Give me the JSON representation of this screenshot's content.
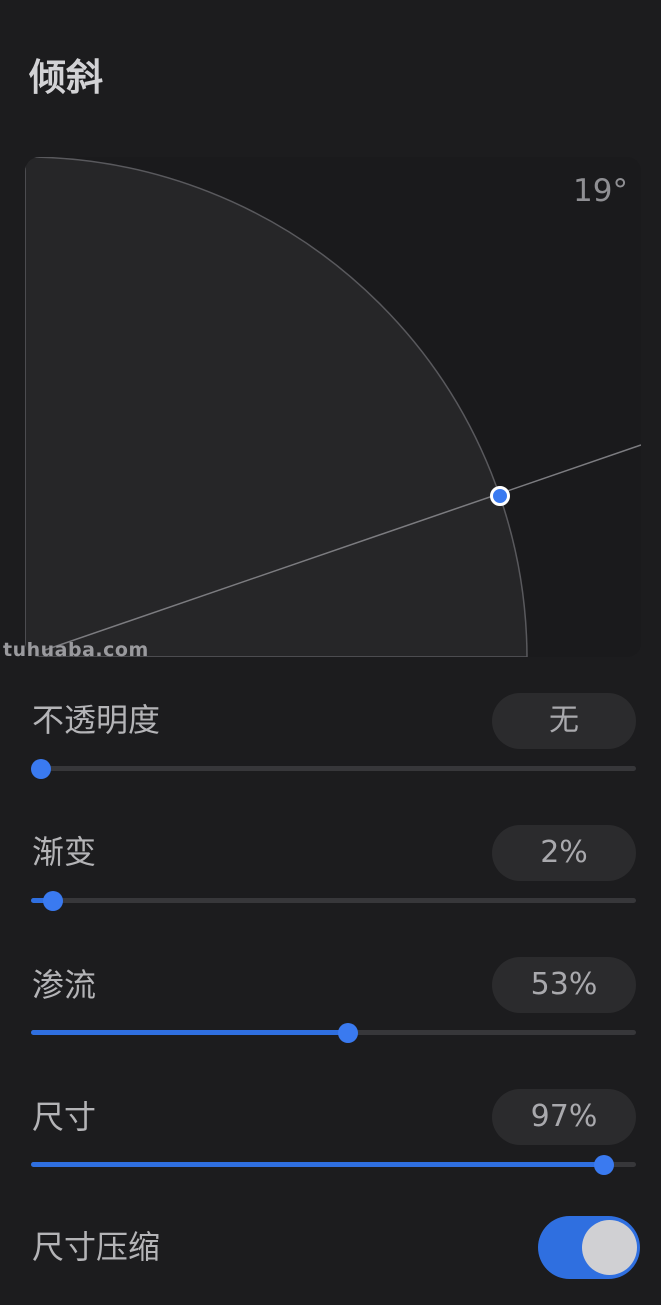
{
  "section_title": "倾斜",
  "tilt": {
    "angle_label": "19°",
    "angle_degrees": 19
  },
  "watermark": "tuhuaba.com",
  "controls": [
    {
      "label": "不透明度",
      "value_label": "无",
      "fraction": 0.0
    },
    {
      "label": "渐变",
      "value_label": "2%",
      "fraction": 0.02
    },
    {
      "label": "渗流",
      "value_label": "53%",
      "fraction": 0.53
    },
    {
      "label": "尺寸",
      "value_label": "97%",
      "fraction": 0.97
    }
  ],
  "toggle": {
    "label": "尺寸压缩",
    "on": true
  },
  "colors": {
    "background": "#1c1c1e",
    "accent": "#3a7af0",
    "track": "#37373a",
    "pill": "#2b2b2d",
    "quarter_disc": "#262628"
  }
}
